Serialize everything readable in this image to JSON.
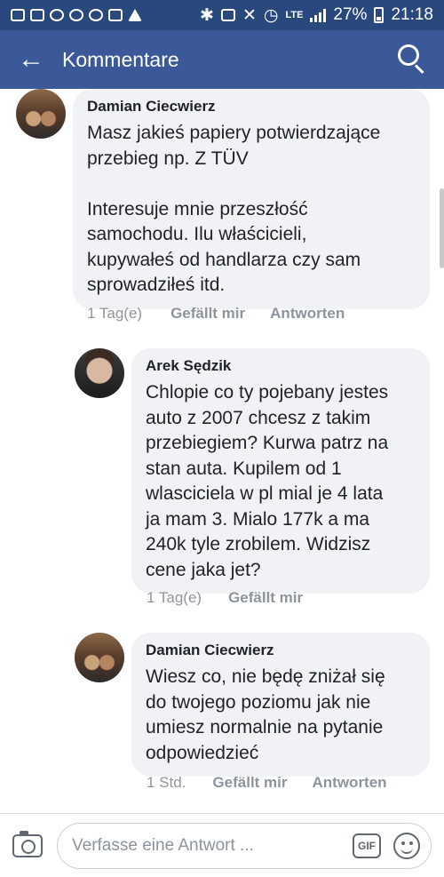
{
  "status_bar": {
    "lte_label": "LTE",
    "battery": "27%",
    "time": "21:18",
    "icons": [
      "message-icon",
      "email-icon",
      "voicemail-icon",
      "voicemail-icon",
      "voicemail-icon",
      "gallery-icon",
      "warning-icon",
      "bluetooth-icon",
      "nfc-icon",
      "mute-icon",
      "alarm-icon",
      "lte-icon",
      "signal-icon",
      "battery-icon"
    ]
  },
  "header": {
    "back_icon": "arrow-left-icon",
    "title": "Kommentare",
    "search_icon": "search-icon",
    "background": "#3b5998"
  },
  "comments": [
    {
      "author": "Damian Ciecwierz",
      "text": "Masz jakieś papiery potwierdzające\nprzebieg np. Z TÜV\n\nInteresuje mnie przeszłość\nsamochodu. Ilu właścicieli,\nkupywałeś od handlarza czy sam\nsprowadziłeś itd.",
      "time": "1 Tag(e)",
      "like_label": "Gefällt mir",
      "reply_label": "Antworten"
    },
    {
      "author": "Arek Sędzik",
      "text": "Chlopie co ty pojebany jestes\nauto z 2007 chcesz z takim\nprzebiegiem? Kurwa patrz na\nstan auta. Kupilem od 1\nwlasciciela w pl mial je 4 lata\nja mam 3. Mialo 177k a ma\n240k tyle zrobilem. Widzisz\ncene jaka jet?",
      "time": "1 Tag(e)",
      "like_label": "Gefällt mir"
    },
    {
      "author": "Damian Ciecwierz",
      "text": "Wiesz co, nie będę zniżał się\ndo twojego poziomu jak nie\numiesz normalnie na pytanie\nodpowiedzieć",
      "time": "1 Std.",
      "like_label": "Gefällt mir",
      "reply_label": "Antworten"
    }
  ],
  "reply_bar": {
    "camera_icon": "camera-icon",
    "placeholder": "Verfasse eine Antwort ...",
    "gif_label": "GIF",
    "emoji_icon": "smiley-icon"
  }
}
